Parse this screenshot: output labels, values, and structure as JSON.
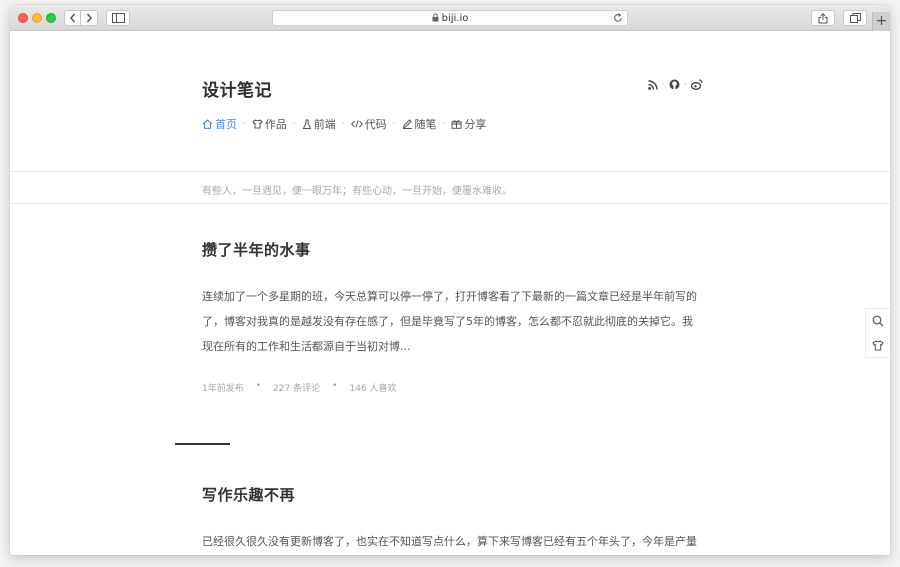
{
  "browser": {
    "url": "biji.io",
    "new_tab_symbol": "+"
  },
  "site": {
    "title": "设计笔记",
    "social": [
      "rss-icon",
      "github-icon",
      "weibo-icon"
    ],
    "social_separator": "·",
    "nav_separator": "·",
    "nav": [
      {
        "label": "首页",
        "icon": "home-icon",
        "active": true
      },
      {
        "label": "作品",
        "icon": "shirt-icon",
        "active": false
      },
      {
        "label": "前端",
        "icon": "tube-icon",
        "active": false
      },
      {
        "label": "代码",
        "icon": "code-icon",
        "active": false
      },
      {
        "label": "随笔",
        "icon": "pen-icon",
        "active": false
      },
      {
        "label": "分享",
        "icon": "gift-icon",
        "active": false
      }
    ],
    "motto": "有些人，一旦遇见，便一眼万年；有些心动，一旦开始，便覆水难收。"
  },
  "posts": [
    {
      "title": "攒了半年的水事",
      "excerpt": "连续加了一个多星期的班，今天总算可以停一停了，打开博客看了下最新的一篇文章已经是半年前写的了，博客对我真的是越发没有存在感了，但是毕竟写了5年的博客，怎么都不忍就此彻底的关掉它。我现在所有的工作和生活都源自于当初对博...",
      "meta": {
        "time": "1年前发布",
        "comments": "227 条评论",
        "likes": "146 人喜欢",
        "separator": "•"
      }
    },
    {
      "title": "写作乐趣不再",
      "excerpt": "已经很久很久没有更新博客了，也实在不知道写点什么，算下来写博客已经有五个年头了，今年是产量"
    }
  ],
  "side_tools": [
    "search-icon",
    "shirt-icon"
  ],
  "colors": {
    "accent": "#4a8bd6",
    "text": "#555555",
    "muted": "#a8a8a8",
    "title": "#333333"
  }
}
